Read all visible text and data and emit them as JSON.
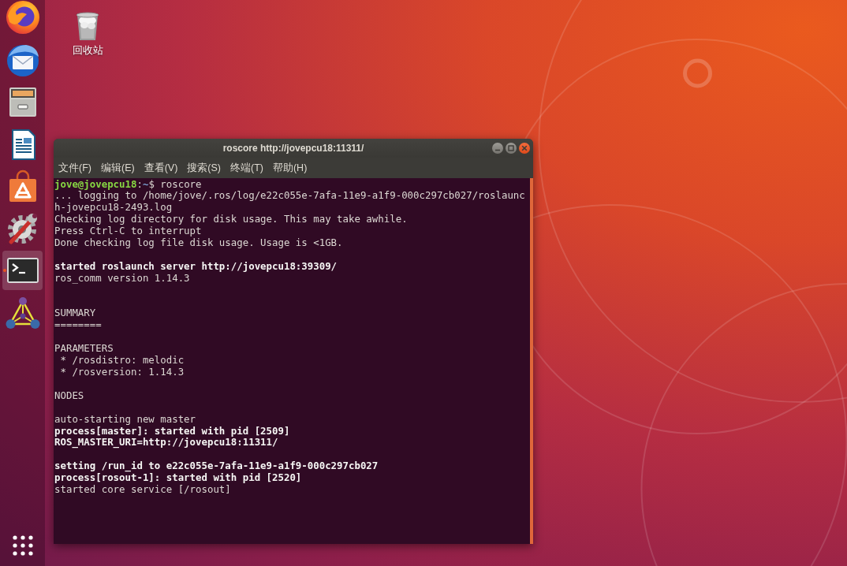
{
  "dock": {
    "items": [
      {
        "kind": "browser",
        "selected": false,
        "running": false
      },
      {
        "kind": "mail",
        "selected": false,
        "running": false
      },
      {
        "kind": "files",
        "selected": false,
        "running": false
      },
      {
        "kind": "writer",
        "selected": false,
        "running": false
      },
      {
        "kind": "store",
        "selected": false,
        "running": false
      },
      {
        "kind": "settings",
        "selected": false,
        "running": false
      },
      {
        "kind": "terminal",
        "selected": true,
        "running": true
      },
      {
        "kind": "ros",
        "selected": false,
        "running": false
      }
    ]
  },
  "desktop": {
    "icons": [
      {
        "label": "回收站"
      }
    ]
  },
  "window": {
    "title": "roscore http://jovepcu18:11311/",
    "menu": [
      {
        "label": "文件(F)"
      },
      {
        "label": "编辑(E)"
      },
      {
        "label": "查看(V)"
      },
      {
        "label": "搜索(S)"
      },
      {
        "label": "终端(T)"
      },
      {
        "label": "帮助(H)"
      }
    ]
  },
  "terminal": {
    "lines": [
      {
        "kind": "prompt",
        "segments": [
          {
            "kind": "user",
            "text": "jove@jovepcu18"
          },
          {
            "kind": "plain",
            "text": ":"
          },
          {
            "kind": "path",
            "text": "~"
          },
          {
            "kind": "plain",
            "text": "$ roscore"
          }
        ]
      },
      {
        "kind": "plain",
        "text": "... logging to /home/jove/.ros/log/e22c055e-7afa-11e9-a1f9-000c297cb027/roslaunc"
      },
      {
        "kind": "plain",
        "text": "h-jovepcu18-2493.log"
      },
      {
        "kind": "plain",
        "text": "Checking log directory for disk usage. This may take awhile."
      },
      {
        "kind": "plain",
        "text": "Press Ctrl-C to interrupt"
      },
      {
        "kind": "plain",
        "text": "Done checking log file disk usage. Usage is <1GB."
      },
      {
        "kind": "blank"
      },
      {
        "kind": "bold",
        "text": "started roslaunch server http://jovepcu18:39309/"
      },
      {
        "kind": "plain",
        "text": "ros_comm version 1.14.3"
      },
      {
        "kind": "blank"
      },
      {
        "kind": "blank"
      },
      {
        "kind": "plain",
        "text": "SUMMARY"
      },
      {
        "kind": "plain",
        "text": "========"
      },
      {
        "kind": "blank"
      },
      {
        "kind": "plain",
        "text": "PARAMETERS"
      },
      {
        "kind": "plain",
        "text": " * /rosdistro: melodic"
      },
      {
        "kind": "plain",
        "text": " * /rosversion: 1.14.3"
      },
      {
        "kind": "blank"
      },
      {
        "kind": "plain",
        "text": "NODES"
      },
      {
        "kind": "blank"
      },
      {
        "kind": "plain",
        "text": "auto-starting new master"
      },
      {
        "kind": "bold",
        "text": "process[master]: started with pid [2509]"
      },
      {
        "kind": "bold",
        "text": "ROS_MASTER_URI=http://jovepcu18:11311/"
      },
      {
        "kind": "blank"
      },
      {
        "kind": "bold",
        "text": "setting /run_id to e22c055e-7afa-11e9-a1f9-000c297cb027"
      },
      {
        "kind": "bold",
        "text": "process[rosout-1]: started with pid [2520]"
      },
      {
        "kind": "plain",
        "text": "started core service [/rosout]"
      }
    ]
  }
}
